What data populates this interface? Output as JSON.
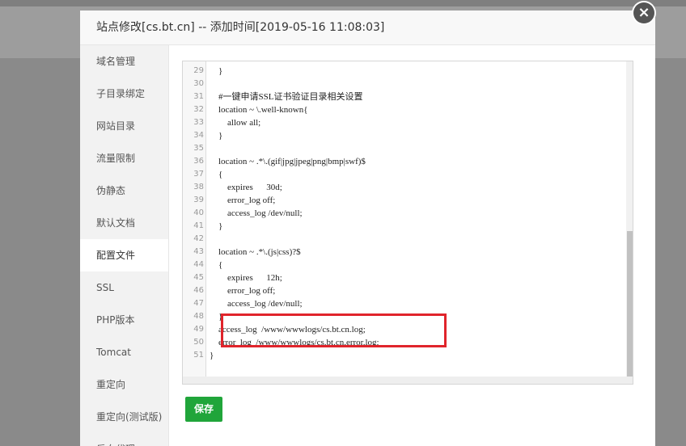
{
  "modal": {
    "title": "站点修改[cs.bt.cn] -- 添加时间[2019-05-16 11:08:03]",
    "close_icon": "×"
  },
  "sidebar": {
    "items": [
      {
        "label": "域名管理",
        "active": false
      },
      {
        "label": "子目录绑定",
        "active": false
      },
      {
        "label": "网站目录",
        "active": false
      },
      {
        "label": "流量限制",
        "active": false
      },
      {
        "label": "伪静态",
        "active": false
      },
      {
        "label": "默认文档",
        "active": false
      },
      {
        "label": "配置文件",
        "active": true
      },
      {
        "label": "SSL",
        "active": false
      },
      {
        "label": "PHP版本",
        "active": false
      },
      {
        "label": "Tomcat",
        "active": false
      },
      {
        "label": "重定向",
        "active": false
      },
      {
        "label": "重定向(测试版)",
        "active": false
      },
      {
        "label": "反向代理",
        "active": false
      }
    ]
  },
  "editor": {
    "lines": [
      {
        "n": "29",
        "text": "    }"
      },
      {
        "n": "30",
        "text": ""
      },
      {
        "n": "31",
        "text": "    #一键申请SSL证书验证目录相关设置"
      },
      {
        "n": "32",
        "text": "    location ~ \\.well-known{"
      },
      {
        "n": "33",
        "text": "        allow all;"
      },
      {
        "n": "34",
        "text": "    }"
      },
      {
        "n": "35",
        "text": ""
      },
      {
        "n": "36",
        "text": "    location ~ .*\\.(gif|jpg|jpeg|png|bmp|swf)$"
      },
      {
        "n": "37",
        "text": "    {"
      },
      {
        "n": "38",
        "text": "        expires      30d;"
      },
      {
        "n": "39",
        "text": "        error_log off;"
      },
      {
        "n": "40",
        "text": "        access_log /dev/null;"
      },
      {
        "n": "41",
        "text": "    }"
      },
      {
        "n": "42",
        "text": ""
      },
      {
        "n": "43",
        "text": "    location ~ .*\\.(js|css)?$"
      },
      {
        "n": "44",
        "text": "    {"
      },
      {
        "n": "45",
        "text": "        expires      12h;"
      },
      {
        "n": "46",
        "text": "        error_log off;"
      },
      {
        "n": "47",
        "text": "        access_log /dev/null;"
      },
      {
        "n": "48",
        "text": "    }"
      },
      {
        "n": "49",
        "text": "    access_log  /www/wwwlogs/cs.bt.cn.log;"
      },
      {
        "n": "50",
        "text": "    error_log  /www/wwwlogs/cs.bt.cn.error.log;"
      },
      {
        "n": "51",
        "text": "}"
      }
    ]
  },
  "save_label": "保存",
  "colors": {
    "save_button": "#20a53a",
    "highlight_border": "#e0242b"
  }
}
